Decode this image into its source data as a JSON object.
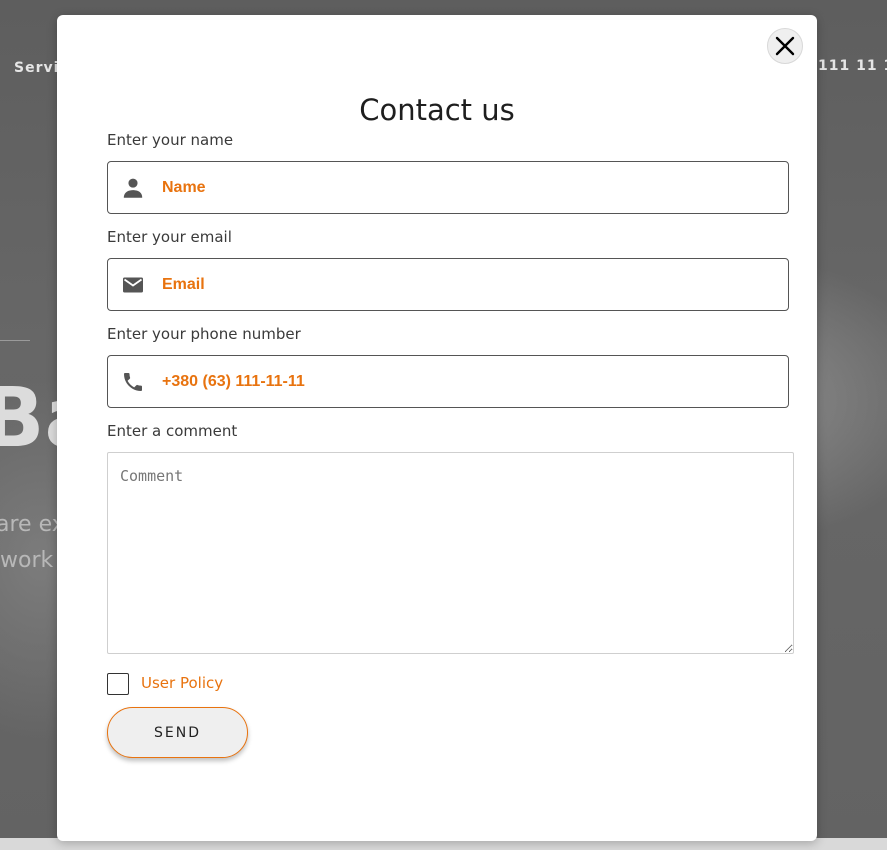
{
  "background": {
    "nav_left": "Servi",
    "nav_right": "111 11 1",
    "hero_text": "Ba",
    "sub_line_1": "are ex",
    "sub_line_2": "work"
  },
  "modal": {
    "title": "Contact us",
    "close_icon": "close-icon",
    "fields": {
      "name": {
        "label": "Enter your name",
        "placeholder": "Name",
        "icon": "person-icon"
      },
      "email": {
        "label": "Enter your email",
        "placeholder": "Email",
        "icon": "mail-icon"
      },
      "phone": {
        "label": "Enter your phone number",
        "placeholder": "+380 (63) 111-11-11",
        "icon": "phone-icon"
      },
      "comment": {
        "label": "Enter a comment",
        "placeholder": "Comment"
      }
    },
    "policy_label": "User Policy",
    "send_label": "SEND"
  },
  "colors": {
    "accent": "#e8730f",
    "overlay": "#6b6b6b",
    "field_border": "#555555"
  }
}
